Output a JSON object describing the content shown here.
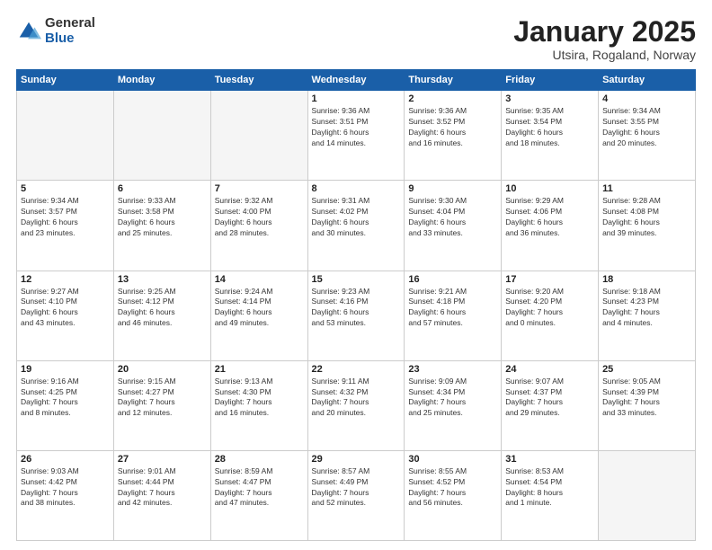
{
  "header": {
    "logo_general": "General",
    "logo_blue": "Blue",
    "month_title": "January 2025",
    "subtitle": "Utsira, Rogaland, Norway"
  },
  "weekdays": [
    "Sunday",
    "Monday",
    "Tuesday",
    "Wednesday",
    "Thursday",
    "Friday",
    "Saturday"
  ],
  "weeks": [
    [
      {
        "day": "",
        "info": ""
      },
      {
        "day": "",
        "info": ""
      },
      {
        "day": "",
        "info": ""
      },
      {
        "day": "1",
        "info": "Sunrise: 9:36 AM\nSunset: 3:51 PM\nDaylight: 6 hours\nand 14 minutes."
      },
      {
        "day": "2",
        "info": "Sunrise: 9:36 AM\nSunset: 3:52 PM\nDaylight: 6 hours\nand 16 minutes."
      },
      {
        "day": "3",
        "info": "Sunrise: 9:35 AM\nSunset: 3:54 PM\nDaylight: 6 hours\nand 18 minutes."
      },
      {
        "day": "4",
        "info": "Sunrise: 9:34 AM\nSunset: 3:55 PM\nDaylight: 6 hours\nand 20 minutes."
      }
    ],
    [
      {
        "day": "5",
        "info": "Sunrise: 9:34 AM\nSunset: 3:57 PM\nDaylight: 6 hours\nand 23 minutes."
      },
      {
        "day": "6",
        "info": "Sunrise: 9:33 AM\nSunset: 3:58 PM\nDaylight: 6 hours\nand 25 minutes."
      },
      {
        "day": "7",
        "info": "Sunrise: 9:32 AM\nSunset: 4:00 PM\nDaylight: 6 hours\nand 28 minutes."
      },
      {
        "day": "8",
        "info": "Sunrise: 9:31 AM\nSunset: 4:02 PM\nDaylight: 6 hours\nand 30 minutes."
      },
      {
        "day": "9",
        "info": "Sunrise: 9:30 AM\nSunset: 4:04 PM\nDaylight: 6 hours\nand 33 minutes."
      },
      {
        "day": "10",
        "info": "Sunrise: 9:29 AM\nSunset: 4:06 PM\nDaylight: 6 hours\nand 36 minutes."
      },
      {
        "day": "11",
        "info": "Sunrise: 9:28 AM\nSunset: 4:08 PM\nDaylight: 6 hours\nand 39 minutes."
      }
    ],
    [
      {
        "day": "12",
        "info": "Sunrise: 9:27 AM\nSunset: 4:10 PM\nDaylight: 6 hours\nand 43 minutes."
      },
      {
        "day": "13",
        "info": "Sunrise: 9:25 AM\nSunset: 4:12 PM\nDaylight: 6 hours\nand 46 minutes."
      },
      {
        "day": "14",
        "info": "Sunrise: 9:24 AM\nSunset: 4:14 PM\nDaylight: 6 hours\nand 49 minutes."
      },
      {
        "day": "15",
        "info": "Sunrise: 9:23 AM\nSunset: 4:16 PM\nDaylight: 6 hours\nand 53 minutes."
      },
      {
        "day": "16",
        "info": "Sunrise: 9:21 AM\nSunset: 4:18 PM\nDaylight: 6 hours\nand 57 minutes."
      },
      {
        "day": "17",
        "info": "Sunrise: 9:20 AM\nSunset: 4:20 PM\nDaylight: 7 hours\nand 0 minutes."
      },
      {
        "day": "18",
        "info": "Sunrise: 9:18 AM\nSunset: 4:23 PM\nDaylight: 7 hours\nand 4 minutes."
      }
    ],
    [
      {
        "day": "19",
        "info": "Sunrise: 9:16 AM\nSunset: 4:25 PM\nDaylight: 7 hours\nand 8 minutes."
      },
      {
        "day": "20",
        "info": "Sunrise: 9:15 AM\nSunset: 4:27 PM\nDaylight: 7 hours\nand 12 minutes."
      },
      {
        "day": "21",
        "info": "Sunrise: 9:13 AM\nSunset: 4:30 PM\nDaylight: 7 hours\nand 16 minutes."
      },
      {
        "day": "22",
        "info": "Sunrise: 9:11 AM\nSunset: 4:32 PM\nDaylight: 7 hours\nand 20 minutes."
      },
      {
        "day": "23",
        "info": "Sunrise: 9:09 AM\nSunset: 4:34 PM\nDaylight: 7 hours\nand 25 minutes."
      },
      {
        "day": "24",
        "info": "Sunrise: 9:07 AM\nSunset: 4:37 PM\nDaylight: 7 hours\nand 29 minutes."
      },
      {
        "day": "25",
        "info": "Sunrise: 9:05 AM\nSunset: 4:39 PM\nDaylight: 7 hours\nand 33 minutes."
      }
    ],
    [
      {
        "day": "26",
        "info": "Sunrise: 9:03 AM\nSunset: 4:42 PM\nDaylight: 7 hours\nand 38 minutes."
      },
      {
        "day": "27",
        "info": "Sunrise: 9:01 AM\nSunset: 4:44 PM\nDaylight: 7 hours\nand 42 minutes."
      },
      {
        "day": "28",
        "info": "Sunrise: 8:59 AM\nSunset: 4:47 PM\nDaylight: 7 hours\nand 47 minutes."
      },
      {
        "day": "29",
        "info": "Sunrise: 8:57 AM\nSunset: 4:49 PM\nDaylight: 7 hours\nand 52 minutes."
      },
      {
        "day": "30",
        "info": "Sunrise: 8:55 AM\nSunset: 4:52 PM\nDaylight: 7 hours\nand 56 minutes."
      },
      {
        "day": "31",
        "info": "Sunrise: 8:53 AM\nSunset: 4:54 PM\nDaylight: 8 hours\nand 1 minute."
      },
      {
        "day": "",
        "info": ""
      }
    ]
  ]
}
